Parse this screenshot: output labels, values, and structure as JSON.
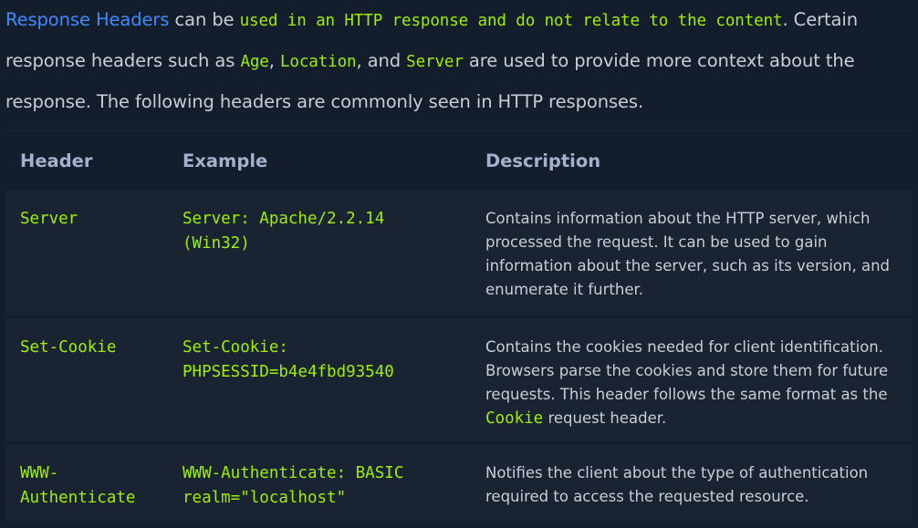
{
  "intro": {
    "link_text": "Response Headers",
    "text1": " can be ",
    "code1": "used in an HTTP response and do not relate to the content",
    "text2": ". Certain response headers such as ",
    "code2": "Age",
    "text3": ", ",
    "code3": "Location",
    "text4": ", and ",
    "code4": "Server",
    "text5": " are used to provide more context about the response. The following headers are commonly seen in HTTP responses."
  },
  "table": {
    "headers": [
      "Header",
      "Example",
      "Description"
    ],
    "rows": [
      {
        "header": "Server",
        "example": "Server: Apache/2.2.14 (Win32)",
        "description": "Contains information about the HTTP server, which processed the request. It can be used to gain information about the server, such as its version, and enumerate it further."
      },
      {
        "header": "Set-Cookie",
        "example": "Set-Cookie: PHPSESSID=b4e4fbd93540",
        "description_part1": "Contains the cookies needed for client identification. Browsers parse the cookies and store them for future requests. This header follows the same format as the ",
        "description_code": "Cookie",
        "description_part2": " request header."
      },
      {
        "header": "WWW-Authenticate",
        "example": "WWW-Authenticate: BASIC realm=\"localhost\"",
        "description": "Notifies the client about the type of authentication required to access the requested resource."
      }
    ]
  }
}
